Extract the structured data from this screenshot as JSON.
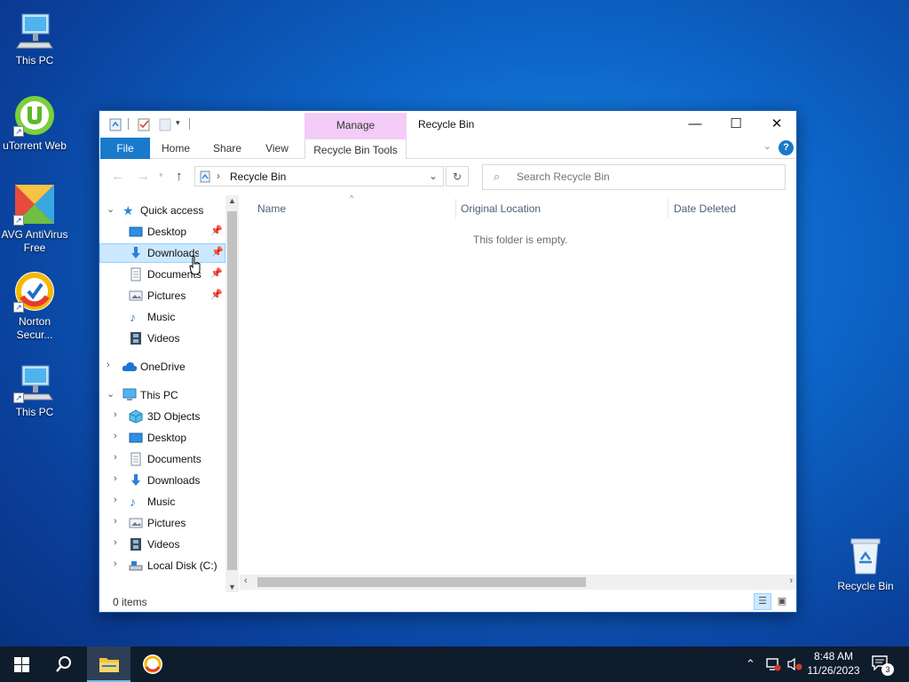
{
  "desktop": {
    "icons": [
      {
        "label": "This PC"
      },
      {
        "label": "uTorrent Web"
      },
      {
        "label": "AVG AntiVirus Free"
      },
      {
        "label": "Norton Secur..."
      },
      {
        "label": "This PC"
      },
      {
        "label": "Recycle Bin"
      }
    ]
  },
  "window": {
    "title": "Recycle Bin",
    "context_group": "Manage",
    "tabs": {
      "file": "File",
      "home": "Home",
      "share": "Share",
      "view": "View",
      "tools": "Recycle Bin Tools"
    },
    "controls": {
      "minimize": "—",
      "maximize": "☐",
      "close": "✕",
      "help": "?"
    },
    "address": {
      "separator": "›",
      "path": "Recycle Bin"
    },
    "search": {
      "placeholder": "Search Recycle Bin"
    },
    "nav_tree": [
      {
        "label": "Quick access"
      },
      {
        "label": "Desktop"
      },
      {
        "label": "Downloads"
      },
      {
        "label": "Documents"
      },
      {
        "label": "Pictures"
      },
      {
        "label": "Music"
      },
      {
        "label": "Videos"
      },
      {
        "label": "OneDrive"
      },
      {
        "label": "This PC"
      },
      {
        "label": "3D Objects"
      },
      {
        "label": "Desktop"
      },
      {
        "label": "Documents"
      },
      {
        "label": "Downloads"
      },
      {
        "label": "Music"
      },
      {
        "label": "Pictures"
      },
      {
        "label": "Videos"
      },
      {
        "label": "Local Disk (C:)"
      }
    ],
    "columns": {
      "name": "Name",
      "original_location": "Original Location",
      "date_deleted": "Date Deleted"
    },
    "empty_message": "This folder is empty.",
    "status": {
      "item_count": "0 items"
    }
  },
  "taskbar": {
    "time": "8:48 AM",
    "date": "11/26/2023",
    "notification_count": "3"
  },
  "colors": {
    "accent": "#1979ca",
    "context_tab": "#f3ccf8",
    "selection": "#cce8ff",
    "taskbar": "#0f1c2c"
  }
}
